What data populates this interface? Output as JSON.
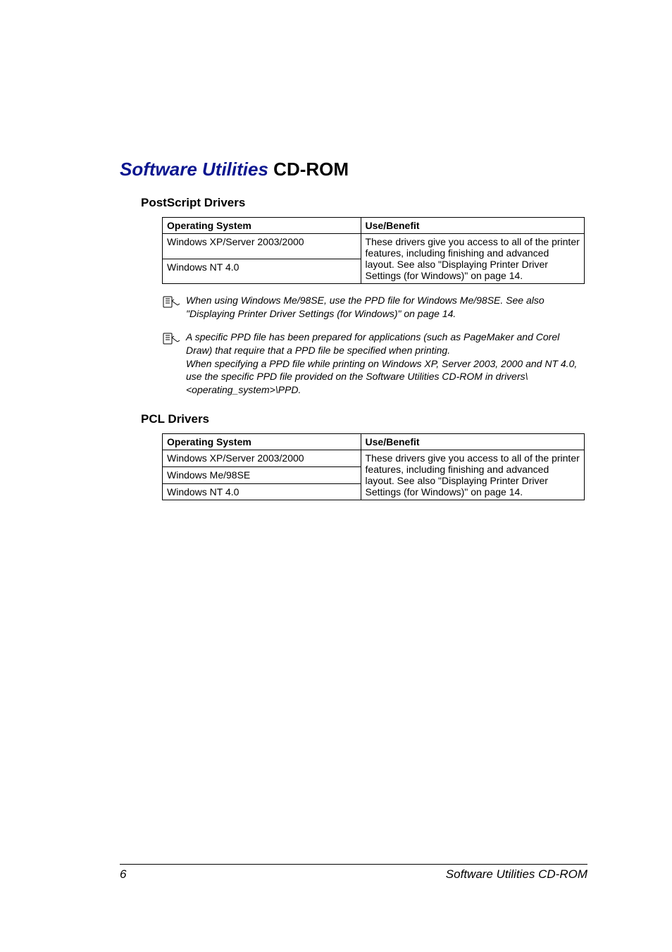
{
  "heading": {
    "italic_blue": "Software Utilities",
    "black_rest": " CD-ROM"
  },
  "postscript": {
    "title": "PostScript Drivers",
    "col1": "Operating System",
    "col2": "Use/Benefit",
    "row1": "Windows XP/Server 2003/2000",
    "row2": "Windows NT 4.0",
    "benefit": "These drivers give you access to all of the printer features, including finishing and advanced layout. See also \"Displaying Printer Driver Settings (for Windows)\" on page 14."
  },
  "note1": "When using Windows Me/98SE, use the PPD file for Windows Me/98SE. See also \"Displaying Printer Driver Settings (for Windows)\" on page 14.",
  "note2": "A specific PPD file has been prepared for applications (such as PageMaker and Corel Draw) that require that a PPD file be specified when printing.\nWhen specifying a PPD file while printing on Windows XP, Server 2003, 2000 and NT 4.0, use the specific PPD file provided on the Software Utilities CD-ROM in drivers\\<operating_system>\\PPD.",
  "pcl": {
    "title": "PCL Drivers",
    "col1": "Operating System",
    "col2": "Use/Benefit",
    "row1": "Windows XP/Server 2003/2000",
    "row2": " Windows Me/98SE",
    "row3": " Windows NT 4.0",
    "benefit": "These drivers give you access to all of the printer features, including finishing and advanced layout. See also \"Displaying Printer Driver Settings (for Windows)\" on page 14."
  },
  "footer": {
    "page": "6",
    "title": "Software Utilities CD-ROM"
  }
}
